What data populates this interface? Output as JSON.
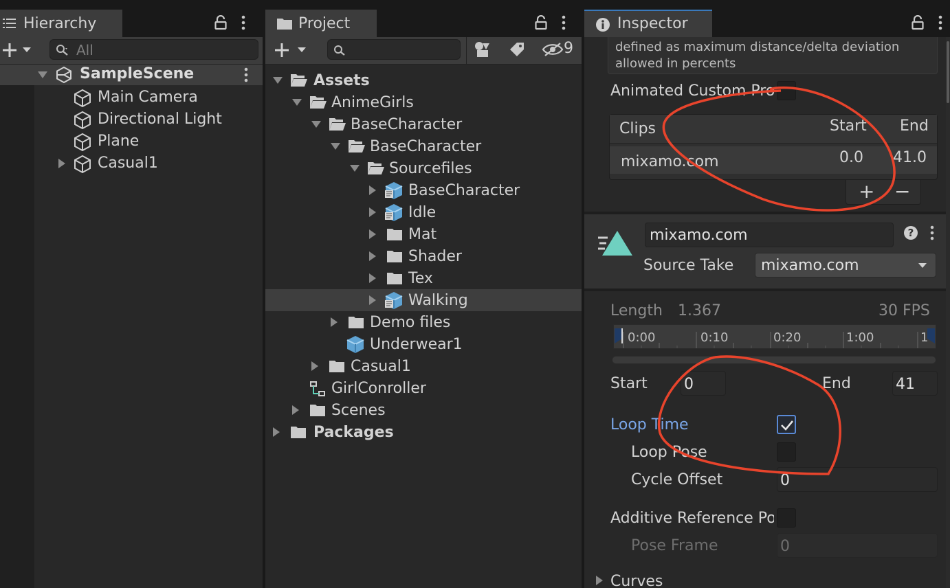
{
  "hierarchy": {
    "tab_label": "Hierarchy",
    "search_placeholder": "All",
    "scene": "SampleScene",
    "items": [
      "Main Camera",
      "Directional Light",
      "Plane",
      "Casual1"
    ]
  },
  "project": {
    "tab_label": "Project",
    "hidden_count": "9",
    "tree": {
      "assets": "Assets",
      "animegirls": "AnimeGirls",
      "basecharacter": "BaseCharacter",
      "basecharacter_inner": "BaseCharacter",
      "sourcefiles": "Sourcefiles",
      "sf_basecharacter": "BaseCharacter",
      "idle": "Idle",
      "mat": "Mat",
      "shader": "Shader",
      "tex": "Tex",
      "walking": "Walking",
      "demo_files": "Demo files",
      "underwear": "Underwear1",
      "casual1": "Casual1",
      "girlconroller": "GirlConroller",
      "scenes": "Scenes",
      "packages": "Packages"
    }
  },
  "inspector": {
    "tab_label": "Inspector",
    "desc_line1": "defined as maximum distance/delta deviation",
    "desc_line2": "allowed in percents",
    "animated_custom": "Animated Custom Pro",
    "clips": {
      "header": "Clips",
      "start_header": "Start",
      "end_header": "End",
      "row_name": "mixamo.com",
      "row_start": "0.0",
      "row_end": "41.0",
      "add": "+",
      "remove": "−"
    },
    "clip_name": "mixamo.com",
    "source_take_label": "Source Take",
    "source_take_value": "mixamo.com",
    "length_label": "Length",
    "length_value": "1.367",
    "fps": "30 FPS",
    "timeline": [
      "0:00",
      "0:10",
      "0:20",
      "1:00",
      "1"
    ],
    "start_label": "Start",
    "start_value": "0",
    "end_label": "End",
    "end_value": "41",
    "loop_time": "Loop Time",
    "loop_time_checked": true,
    "loop_pose": "Loop Pose",
    "loop_pose_checked": false,
    "cycle_offset": "Cycle Offset",
    "cycle_offset_value": "0",
    "additive_ref": "Additive Reference Po",
    "additive_ref_checked": false,
    "pose_frame": "Pose Frame",
    "pose_frame_value": "0",
    "curves": "Curves"
  },
  "colors": {
    "panel_bg": "#282828",
    "tab_bg": "#3c3c3c",
    "selection": "#3e3e3e",
    "link_blue": "#7aa6e8",
    "annotation_red": "#e8442c",
    "unity_teal": "#6fd0c0"
  }
}
